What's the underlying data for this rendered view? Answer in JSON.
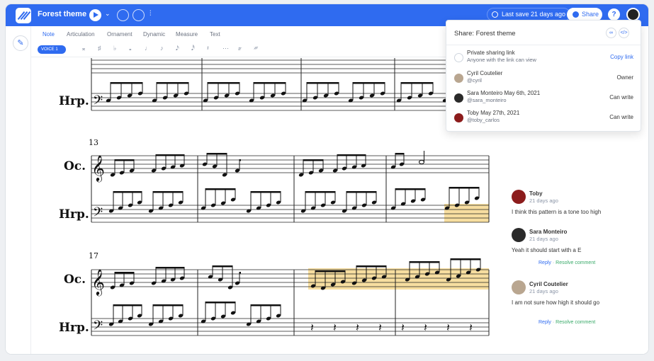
{
  "header": {
    "title": "Forest theme",
    "last_save": "Last save 21 days ago",
    "share_label": "Share",
    "help_label": "?"
  },
  "toolbar": {
    "tabs": [
      "Note",
      "Articulation",
      "Ornament",
      "Dynamic",
      "Measure",
      "Text"
    ],
    "active_tab": "Note",
    "voice_label": "VOICE 1",
    "tools": [
      "𝄪",
      "♯",
      "♭",
      "𝅝",
      "♩",
      "♪",
      "𝅘𝅥𝅯",
      "𝅘𝅥𝅰",
      "𝄽",
      "⋯",
      "𝆖",
      "𝄏"
    ]
  },
  "score": {
    "systems": [
      {
        "measure_number": "",
        "staves": [
          "Hrp."
        ]
      },
      {
        "measure_number": "13",
        "staves": [
          "Oc.",
          "Hrp."
        ]
      },
      {
        "measure_number": "17",
        "staves": [
          "Oc.",
          "Hrp."
        ]
      }
    ],
    "highlight_color": "#f7dea0"
  },
  "share_panel": {
    "title": "Share: Forest theme",
    "rows": [
      {
        "name": "Private sharing link",
        "sub": "Anyone with the link can view",
        "role": "Copy link",
        "avatar": "link-icon",
        "link": true
      },
      {
        "name": "Cyril Coutelier",
        "sub": "@cyril",
        "role": "Owner",
        "avatar": "#b9a690"
      },
      {
        "name": "Sara Monteiro May 6th, 2021",
        "sub": "@sara_monteiro",
        "role": "Can write",
        "avatar": "#2a2a2a"
      },
      {
        "name": "Toby May 27th, 2021",
        "sub": "@toby_carlos",
        "role": "Can write",
        "avatar": "#8c1c1c"
      }
    ]
  },
  "comments": [
    {
      "name": "Toby",
      "time": "21 days ago",
      "text": "I think this pattern is a tone too high",
      "avatar": "#8c1c1c",
      "actions": []
    },
    {
      "name": "Sara Monteiro",
      "time": "21 days ago",
      "text": "Yeah it should start with a E",
      "avatar": "#2a2a2a",
      "actions": [
        "Reply",
        "Resolve comment"
      ]
    },
    {
      "name": "Cyril Coutelier",
      "time": "21 days ago",
      "text": "I am not sure how high it should go",
      "avatar": "#b9a690",
      "actions": [
        "Reply",
        "Resolve comment"
      ]
    }
  ],
  "colors": {
    "accent": "#2f6bf0",
    "resolve": "#3aaa6a"
  }
}
